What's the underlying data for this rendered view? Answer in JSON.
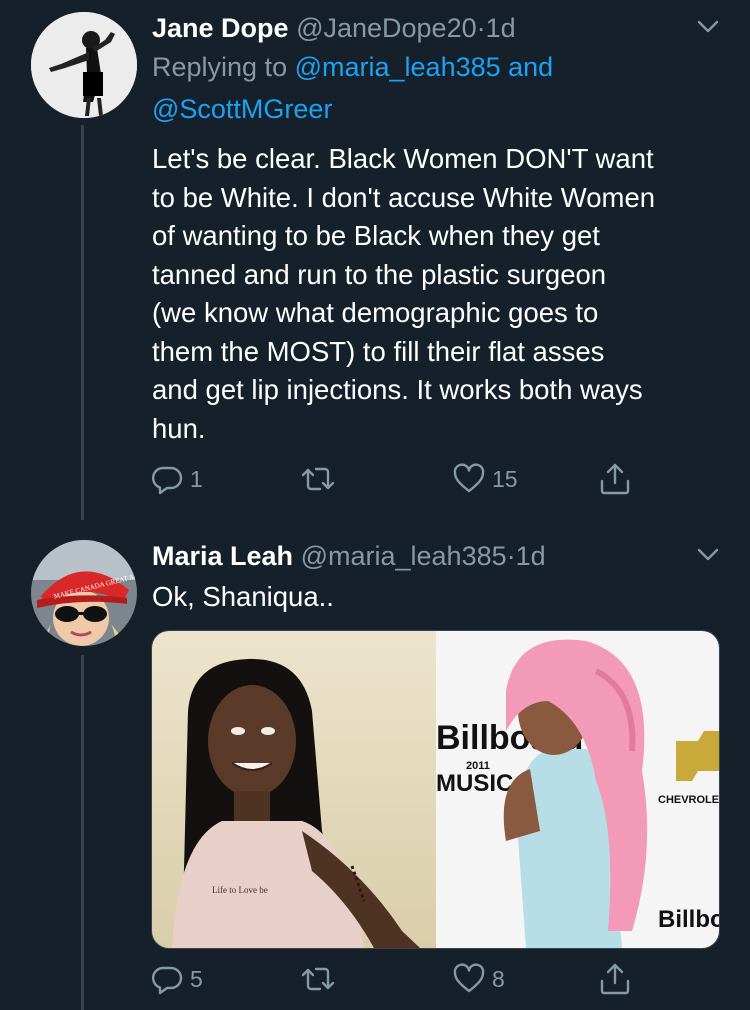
{
  "tweets": [
    {
      "name": "Jane Dope",
      "handle": "@JaneDope20",
      "dot": "·",
      "time": "1d",
      "replying_prefix": "Replying to ",
      "replying_to_1": "@maria_leah385",
      "replying_and": " and",
      "replying_to_2": "@ScottMGreer",
      "text_lines": [
        "Let's be clear. Black Women DON'T want",
        "to be White. I don't accuse White Women",
        "of wanting to be Black when they get",
        "tanned and run to the plastic surgeon",
        "(we know what demographic goes to",
        "them the MOST) to fill their flat asses",
        "and get lip injections. It works both ways",
        "hun."
      ],
      "replies": "1",
      "retweets": "",
      "likes": "15"
    },
    {
      "name": "Maria Leah",
      "handle": "@maria_leah385",
      "dot": "·",
      "time": "1d",
      "text": "Ok, Shaniqua..",
      "replies": "5",
      "retweets": "",
      "likes": "8",
      "hat_text": "MAKE CANADA GREAT AGAIN",
      "media_text": {
        "billboard_1": "Billboard",
        "year": "2011",
        "music_awards": "MUSIC AWARDS",
        "chevrolet": "CHEVROLET",
        "billboard_2": "Billboard",
        "shirt_text": "Life to Love be"
      }
    }
  ],
  "icons": [
    "reply-icon",
    "retweet-icon",
    "like-icon",
    "share-icon",
    "chevron-down-icon"
  ],
  "colors": {
    "background": "#15202b",
    "muted": "#8899a6",
    "link": "#1da1f2",
    "divider": "#38444d",
    "text": "#ffffff"
  }
}
